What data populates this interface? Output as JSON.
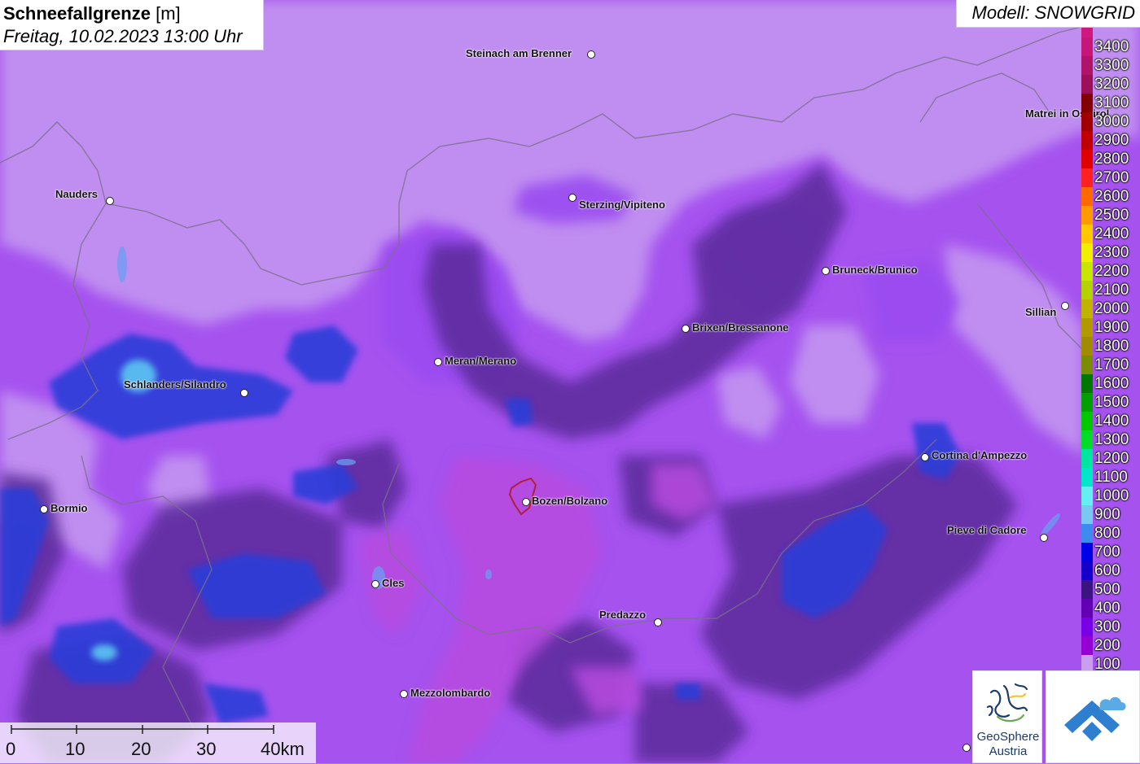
{
  "header": {
    "title_bold": "Schneefallgrenze",
    "title_unit": "[m]",
    "datetime": "Freitag, 10.02.2023 13:00 Uhr",
    "model": "Modell: SNOWGRID"
  },
  "legend": {
    "unit": "m",
    "values": [
      3400,
      3300,
      3200,
      3100,
      3000,
      2900,
      2800,
      2700,
      2600,
      2500,
      2400,
      2300,
      2200,
      2100,
      2000,
      1900,
      1800,
      1700,
      1600,
      1500,
      1400,
      1300,
      1200,
      1100,
      1000,
      900,
      800,
      700,
      600,
      500,
      400,
      300,
      200,
      100
    ],
    "colors": [
      "#c7167a",
      "#b0136a",
      "#9c0f5a",
      "#820000",
      "#a00000",
      "#c00000",
      "#e00000",
      "#ff2020",
      "#ff6a00",
      "#ff9a00",
      "#ffc800",
      "#f0f000",
      "#c8e600",
      "#b4d200",
      "#c0b400",
      "#b09a00",
      "#a08c00",
      "#7a8c00",
      "#007800",
      "#00a000",
      "#00c800",
      "#00dc28",
      "#00e6a0",
      "#00e6c8",
      "#64f0f0",
      "#78c8f0",
      "#3c8cf0",
      "#0000e6",
      "#1400c8",
      "#3c1482",
      "#6400b4",
      "#7800e6",
      "#9600d2",
      "#c89ff0"
    ]
  },
  "cities": [
    {
      "name": "Steinach am Brenner"
    },
    {
      "name": "Nauders"
    },
    {
      "name": "Sterzing/Vipiteno"
    },
    {
      "name": "Matrei in Osttirol"
    },
    {
      "name": "Bruneck/Brunico"
    },
    {
      "name": "Sillian"
    },
    {
      "name": "Brixen/Bressanone"
    },
    {
      "name": "Meran/Merano"
    },
    {
      "name": "Schlanders/Silandro"
    },
    {
      "name": "Cortina d'Ampezzo"
    },
    {
      "name": "Bozen/Bolzano"
    },
    {
      "name": "Bormio"
    },
    {
      "name": "Pieve di Cadore"
    },
    {
      "name": "Cles"
    },
    {
      "name": "Predazzo"
    },
    {
      "name": "Mezzolombardo"
    }
  ],
  "scale_bar": {
    "labels": [
      "0",
      "10",
      "20",
      "30",
      "40km"
    ]
  },
  "logos": {
    "geosphere_line1": "GeoSphere",
    "geosphere_line2": "Austria"
  },
  "map_colors": {
    "light_violet": "#c08ef0",
    "violet": "#9a4cf0",
    "magenta_violet": "#a03cdc",
    "dark_violet": "#5a2a9a",
    "blue": "#2a3ed8",
    "light_blue": "#58b8f0",
    "pinkish": "#b84ce0"
  }
}
